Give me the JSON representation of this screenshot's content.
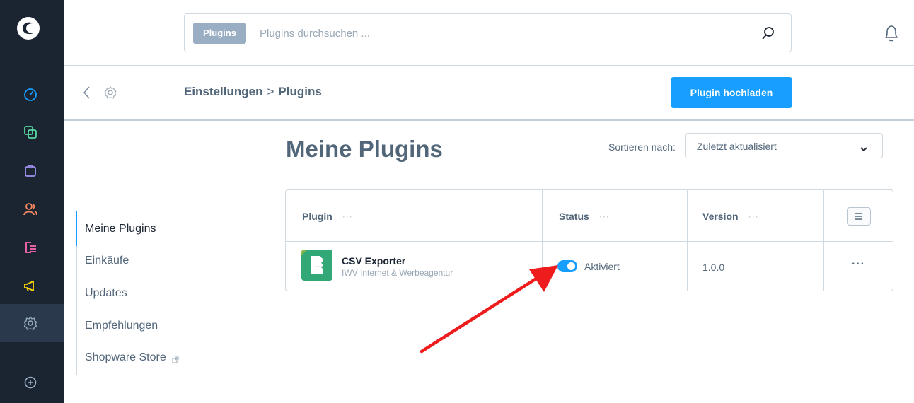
{
  "menu": {
    "items": [
      {
        "icon": "dashboard-icon",
        "color": "#189eff"
      },
      {
        "icon": "catalog-icon",
        "color": "#57d9a3"
      },
      {
        "icon": "orders-icon",
        "color": "#a092f0"
      },
      {
        "icon": "customers-icon",
        "color": "#f88962"
      },
      {
        "icon": "content-icon",
        "color": "#ff68b4"
      },
      {
        "icon": "marketing-icon",
        "color": "#ffd700"
      },
      {
        "icon": "settings-icon",
        "color": "#9aaec3"
      },
      {
        "icon": "add-icon",
        "color": "#9aaec3"
      }
    ]
  },
  "header": {
    "search_type": "Plugins",
    "search_placeholder": "Plugins durchsuchen ..."
  },
  "smartbar": {
    "breadcrumb_parent": "Einstellungen",
    "breadcrumb_separator": ">",
    "breadcrumb_current": "Plugins",
    "upload_label": "Plugin hochladen"
  },
  "sidenav": {
    "items": [
      {
        "label": "Meine Plugins",
        "active": true
      },
      {
        "label": "Einkäufe"
      },
      {
        "label": "Updates"
      },
      {
        "label": "Empfehlungen"
      },
      {
        "label": "Shopware Store",
        "external": true
      }
    ]
  },
  "main": {
    "title": "Meine Plugins",
    "sort_label": "Sortieren nach:",
    "sort_value": "Zuletzt aktualisiert",
    "table": {
      "columns": [
        "Plugin",
        "Status",
        "Version"
      ],
      "column_dots": "···",
      "rows": [
        {
          "name": "CSV Exporter",
          "author": "IWV Internet & Werbeagentur",
          "status": "Aktiviert",
          "active": true,
          "version": "1.0.0",
          "actions": "···"
        }
      ]
    }
  },
  "colors": {
    "accent": "#189eff",
    "sidebar": "#1b2532",
    "plugin_icon": "#32a877",
    "annotation_arrow": "#ee1c1c"
  }
}
